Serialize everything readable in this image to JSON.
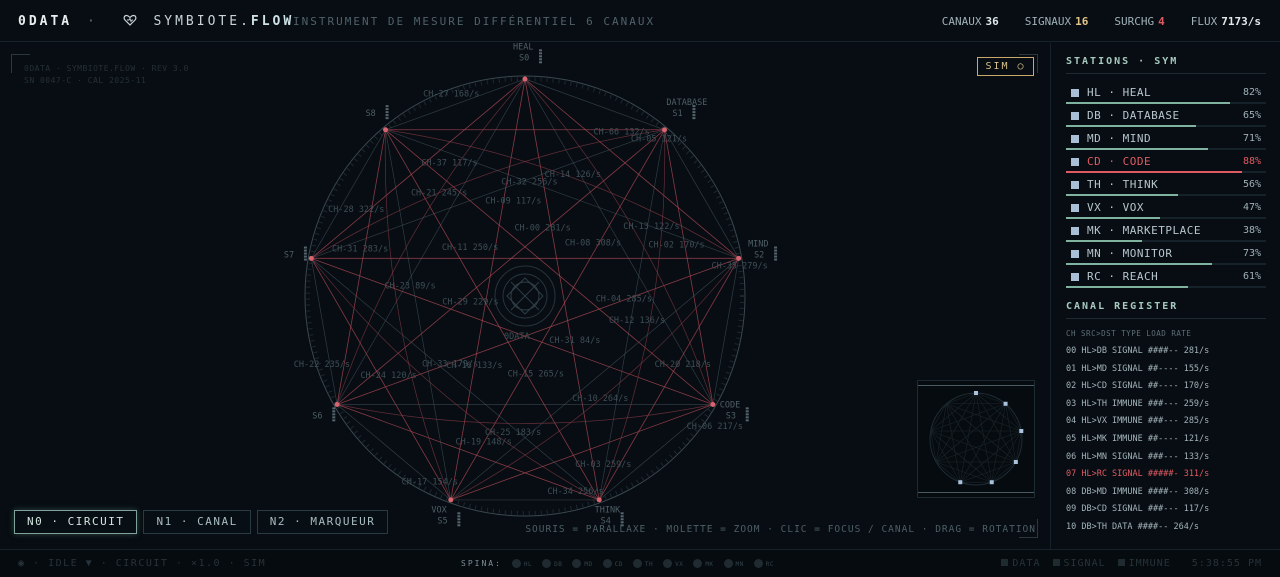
{
  "header": {
    "brand": "0DATA",
    "separator": "·",
    "brand_product": "SYMBIOTE.",
    "brand_flow": "FLOW",
    "subtitle": "INSTRUMENT DE MESURE DIFFÉRENTIEL 6 CANAUX",
    "stats": [
      {
        "label": "CANAUX",
        "value": "36",
        "color": "#dfe8ea"
      },
      {
        "label": "SIGNAUX",
        "value": "16",
        "color": "#e2c48a"
      },
      {
        "label": "SURCHG",
        "value": "4",
        "color": "#e05a63"
      },
      {
        "label": "FLUX",
        "value": "7173/s",
        "color": "#dfe8ea"
      }
    ]
  },
  "meta": {
    "line1": "0DATA · SYMBIOTE.FLOW · REV 3.0",
    "line2": "SN 0047-C · CAL 2025-11"
  },
  "sim_button": "SIM ○",
  "circuit": {
    "center_label": "0DATA",
    "nodes": [
      {
        "id": "S0",
        "label": "HEAL"
      },
      {
        "id": "S1",
        "label": "DATABASE"
      },
      {
        "id": "S2",
        "label": "MIND"
      },
      {
        "id": "S3",
        "label": "CODE"
      },
      {
        "id": "S4",
        "label": "THINK"
      },
      {
        "id": "S5",
        "label": "VOX"
      },
      {
        "id": "S6",
        "label": ""
      },
      {
        "id": "S7",
        "label": ""
      },
      {
        "id": "S8",
        "label": ""
      }
    ],
    "channels": [
      "CH-00 281/s",
      "CH-14 126/s",
      "CH-66 132/s",
      "CH-05 121/s",
      "CH-08 308/s",
      "CH-13 122/s",
      "CH-02 170/s",
      "CH-35 279/s",
      "CH-04 285/s",
      "CH-12 136/s",
      "CH-20 218/s",
      "CH-06 217/s",
      "CH-31 84/s",
      "CH-10 264/s",
      "CH-03 259/s",
      "CH-34 256/s",
      "CH-15 265/s",
      "CH-25 183/s",
      "CH-19 148/s",
      "CH-17 154/s",
      "CH-16 133/s",
      "CH-33 179/s",
      "CH-24 120/s",
      "CH-22 235/s",
      "CH-29 229/s",
      "CH-23 89/s",
      "CH-31 283/s",
      "CH-28 322/s",
      "CH-11 250/s",
      "CH-21 245/s",
      "CH-37 117/s",
      "CH-27 168/s",
      "CH-09 117/s",
      "CH-32 256/s"
    ]
  },
  "modes": [
    {
      "label": "N0 · CIRCUIT",
      "active": true
    },
    {
      "label": "N1 · CANAL",
      "active": false
    },
    {
      "label": "N2 · MARQUEUR",
      "active": false
    }
  ],
  "hint": "SOURIS = PARALLAXE · MOLETTE = ZOOM · CLIC = FOCUS / CANAL · DRAG = ROTATION",
  "stations": {
    "title": "STATIONS · SYM",
    "items": [
      {
        "label": "HL · HEAL",
        "value": 82,
        "pct": "82%",
        "hot": false
      },
      {
        "label": "DB · DATABASE",
        "value": 65,
        "pct": "65%",
        "hot": false
      },
      {
        "label": "MD · MIND",
        "value": 71,
        "pct": "71%",
        "hot": false
      },
      {
        "label": "CD · CODE",
        "value": 88,
        "pct": "88%",
        "hot": true
      },
      {
        "label": "TH · THINK",
        "value": 56,
        "pct": "56%",
        "hot": false
      },
      {
        "label": "VX · VOX",
        "value": 47,
        "pct": "47%",
        "hot": false
      },
      {
        "label": "MK · MARKETPLACE",
        "value": 38,
        "pct": "38%",
        "hot": false
      },
      {
        "label": "MN · MONITOR",
        "value": 73,
        "pct": "73%",
        "hot": false
      },
      {
        "label": "RC · REACH",
        "value": 61,
        "pct": "61%",
        "hot": false
      }
    ]
  },
  "register": {
    "title": "CANAL REGISTER",
    "header": "CH SRC>DST TYPE LOAD RATE",
    "rows": [
      {
        "text": "00 HL>DB SIGNAL ####-- 281/s",
        "hot": false
      },
      {
        "text": "01 HL>MD SIGNAL ##---- 155/s",
        "hot": false
      },
      {
        "text": "02 HL>CD SIGNAL ##---- 170/s",
        "hot": false
      },
      {
        "text": "03 HL>TH IMMUNE ###--- 259/s",
        "hot": false
      },
      {
        "text": "04 HL>VX IMMUNE ###--- 285/s",
        "hot": false
      },
      {
        "text": "05 HL>MK IMMUNE ##---- 121/s",
        "hot": false
      },
      {
        "text": "06 HL>MN SIGNAL ###--- 133/s",
        "hot": false
      },
      {
        "text": "07 HL>RC SIGNAL #####- 311/s",
        "hot": true
      },
      {
        "text": "08 DB>MD IMMUNE ####-- 308/s",
        "hot": false
      },
      {
        "text": "09 DB>CD SIGNAL ###--- 117/s",
        "hot": false
      },
      {
        "text": "10 DB>TH DATA ####-- 264/s",
        "hot": false
      }
    ]
  },
  "footer": {
    "left": "◉ · IDLE ▼ · CIRCUIT · ×1.0 · SIM",
    "spina_label": "SPINA:",
    "spina": [
      "HL",
      "DB",
      "MD",
      "CD",
      "TH",
      "VX",
      "MK",
      "MN",
      "RC"
    ],
    "legend": [
      "DATA",
      "SIGNAL",
      "IMMUNE"
    ],
    "time": "5:38:55 PM"
  },
  "colors": {
    "accent": "#a8c9bf",
    "signal": "#e05a63",
    "sim": "#c9a96a"
  }
}
